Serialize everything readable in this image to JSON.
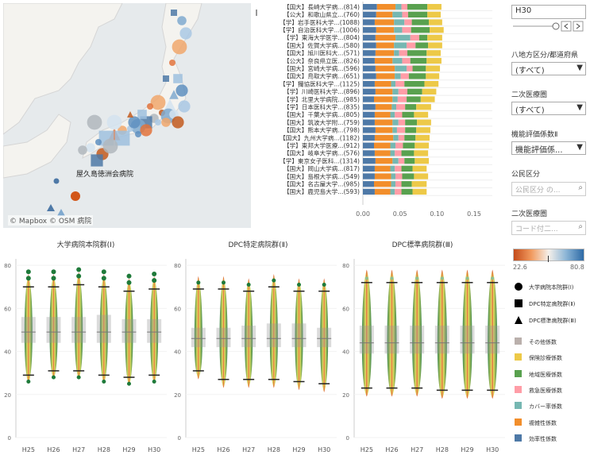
{
  "map": {
    "credit": "© Mapbox  © OSM",
    "hospital_label": "屋久島徳洲会病院",
    "partial_label": "病院"
  },
  "bars": {
    "labels": [
      "【国大】長崎大学病...(814)",
      "【公大】和歌山県立...(760)",
      "【学】岩手医科大学...(1088)",
      "【学】自治医科大学...(1006)",
      "【学】東海大学医学...(804)",
      "【国大】佐賀大学病...(580)",
      "【国大】旭川医科大...(571)",
      "【公大】奈良県立医...(826)",
      "【国大】宮崎大学病...(596)",
      "【国大】鳥取大学病...(651)",
      "【学】獨協医科大学...(1125)",
      "【学】川崎医科大学...(896)",
      "【学】北里大学病院...(985)",
      "【学】日本医科大学...(835)",
      "【国大】千葉大学病...(805)",
      "【国大】筑波大学附...(759)",
      "【国大】熊本大学病...(798)",
      "【国大】九州大学病...(1182)",
      "【学】東邦大学医療...(912)",
      "【国大】岐阜大学病...(576)",
      "【学】東京女子医科...(1314)",
      "【国大】岡山大学病...(817)",
      "【国大】島根大学病...(549)",
      "【国大】名古屋大学...(985)",
      "【国大】鹿児島大学...(593)"
    ],
    "axis_ticks": [
      "0.00",
      "0.05",
      "0.10",
      "0.15"
    ]
  },
  "filters": {
    "year": "H30",
    "region_label": "八地方区分/都道府県",
    "region_value": "(すべて)",
    "medical_area_label": "二次医療圏",
    "medical_area_value": "(すべて)",
    "coef_label": "機能評価係数Ⅱ",
    "coef_value": "機能評価係...",
    "public_label": "公民区分",
    "public_placeholder": "公民区分 の...",
    "area2_label": "二次医療圏",
    "area2_placeholder": "コード付二..."
  },
  "color_scale": {
    "min": "22.6",
    "max": "80.8"
  },
  "shape_legend": [
    {
      "shape": "circle",
      "label": "大学病院本院群(Ⅰ)"
    },
    {
      "shape": "square",
      "label": "DPC特定病院群(Ⅱ)"
    },
    {
      "shape": "triangle",
      "label": "DPC標準病院群(Ⅲ)"
    }
  ],
  "color_legend": [
    {
      "label": "その他係数",
      "color": "#bab0ac"
    },
    {
      "label": "保険診療係数",
      "color": "#edc948"
    },
    {
      "label": "地域医療係数",
      "color": "#59a14f"
    },
    {
      "label": "救急医療係数",
      "color": "#ff9da7"
    },
    {
      "label": "カバー率係数",
      "color": "#76b7b2"
    },
    {
      "label": "複雑性係数",
      "color": "#f28e2b"
    },
    {
      "label": "効率性係数",
      "color": "#4e79a7"
    }
  ],
  "violin": {
    "titles": [
      "大学病院本院群(Ⅰ)",
      "DPC特定病院群(Ⅱ)",
      "DPC標準病院群(Ⅲ)"
    ],
    "years": [
      "H25",
      "H26",
      "H27",
      "H28",
      "H29",
      "H30"
    ],
    "y_ticks": [
      "0",
      "20",
      "40",
      "60",
      "80"
    ]
  },
  "chart_data": [
    {
      "type": "bar",
      "title": "",
      "stacked": true,
      "orientation": "horizontal",
      "categories": [
        "【国大】長崎大学病...(814)",
        "【公大】和歌山県立...(760)",
        "【学】岩手医科大学...(1088)",
        "【学】自治医科大学...(1006)",
        "【学】東海大学医学...(804)",
        "【国大】佐賀大学病...(580)",
        "【国大】旭川医科大...(571)",
        "【公大】奈良県立医...(826)",
        "【国大】宮崎大学病...(596)",
        "【国大】鳥取大学病...(651)",
        "【学】獨協医科大学...(1125)",
        "【学】川崎医科大学...(896)",
        "【学】北里大学病院...(985)",
        "【学】日本医科大学...(835)",
        "【国大】千葉大学病...(805)",
        "【国大】筑波大学附...(759)",
        "【国大】熊本大学病...(798)",
        "【国大】九州大学病...(1182)",
        "【学】東邦大学医療...(912)",
        "【国大】岐阜大学病...(576)",
        "【学】東京女子医科...(1314)",
        "【国大】岡山大学病...(817)",
        "【国大】島根大学病...(549)",
        "【国大】名古屋大学...(985)",
        "【国大】鹿児島大学...(593)"
      ],
      "series": [
        {
          "name": "効率性係数",
          "values": [
            0.019,
            0.018,
            0.016,
            0.018,
            0.017,
            0.018,
            0.017,
            0.016,
            0.017,
            0.018,
            0.016,
            0.017,
            0.015,
            0.017,
            0.016,
            0.016,
            0.017,
            0.016,
            0.015,
            0.016,
            0.017,
            0.016,
            0.016,
            0.015,
            0.016
          ]
        },
        {
          "name": "複雑性係数",
          "values": [
            0.025,
            0.022,
            0.026,
            0.024,
            0.027,
            0.024,
            0.025,
            0.024,
            0.026,
            0.025,
            0.022,
            0.023,
            0.025,
            0.022,
            0.021,
            0.024,
            0.023,
            0.025,
            0.022,
            0.021,
            0.023,
            0.021,
            0.022,
            0.023,
            0.021
          ]
        },
        {
          "name": "カバー率係数",
          "values": [
            0.008,
            0.013,
            0.014,
            0.011,
            0.02,
            0.017,
            0.007,
            0.013,
            0.016,
            0.008,
            0.006,
            0.008,
            0.007,
            0.006,
            0.006,
            0.008,
            0.006,
            0.007,
            0.007,
            0.006,
            0.008,
            0.006,
            0.006,
            0.006,
            0.006
          ]
        },
        {
          "name": "救急医療係数",
          "values": [
            0.008,
            0.008,
            0.01,
            0.012,
            0.012,
            0.012,
            0.011,
            0.011,
            0.008,
            0.011,
            0.012,
            0.012,
            0.012,
            0.012,
            0.01,
            0.009,
            0.011,
            0.008,
            0.01,
            0.009,
            0.008,
            0.009,
            0.009,
            0.008,
            0.009
          ]
        },
        {
          "name": "地域医療係数",
          "values": [
            0.027,
            0.026,
            0.023,
            0.025,
            0.011,
            0.017,
            0.026,
            0.022,
            0.018,
            0.023,
            0.027,
            0.02,
            0.019,
            0.015,
            0.016,
            0.016,
            0.015,
            0.015,
            0.016,
            0.017,
            0.014,
            0.015,
            0.016,
            0.014,
            0.015
          ]
        },
        {
          "name": "保険診療係数",
          "values": [
            0.019,
            0.018,
            0.018,
            0.019,
            0.02,
            0.019,
            0.019,
            0.02,
            0.019,
            0.018,
            0.019,
            0.019,
            0.019,
            0.02,
            0.019,
            0.019,
            0.019,
            0.019,
            0.019,
            0.019,
            0.019,
            0.019,
            0.019,
            0.02,
            0.019
          ]
        }
      ],
      "xlim": [
        0,
        0.16
      ]
    },
    {
      "type": "scatter",
      "title": "大学病院本院群(Ⅰ)",
      "x": [
        "H25",
        "H26",
        "H27",
        "H28",
        "H29",
        "H30"
      ],
      "median": [
        49,
        49,
        49,
        49,
        49,
        49
      ],
      "q1": [
        44,
        44,
        44,
        44,
        44,
        44
      ],
      "q3": [
        56,
        56,
        56,
        57,
        55,
        55
      ],
      "whisker_low": [
        29,
        31,
        31,
        29,
        28,
        29
      ],
      "whisker_high": [
        70,
        70,
        71,
        70,
        68,
        69
      ],
      "ylim": [
        0,
        80
      ]
    },
    {
      "type": "scatter",
      "title": "DPC特定病院群(Ⅱ)",
      "x": [
        "H25",
        "H26",
        "H27",
        "H28",
        "H29",
        "H30"
      ],
      "median": [
        46,
        46,
        46,
        46,
        46,
        46
      ],
      "q1": [
        42,
        42,
        42,
        42,
        42,
        42
      ],
      "q3": [
        51,
        51,
        52,
        53,
        53,
        51
      ],
      "whisker_low": [
        31,
        27,
        27,
        27,
        26,
        25
      ],
      "whisker_high": [
        69,
        69,
        68,
        70,
        68,
        68
      ],
      "ylim": [
        0,
        80
      ]
    },
    {
      "type": "scatter",
      "title": "DPC標準病院群(Ⅲ)",
      "x": [
        "H25",
        "H26",
        "H27",
        "H28",
        "H29",
        "H30"
      ],
      "median": [
        44,
        44,
        44,
        44,
        44,
        44
      ],
      "q1": [
        39,
        39,
        39,
        39,
        39,
        39
      ],
      "q3": [
        52,
        52,
        52,
        52,
        52,
        52
      ],
      "whisker_low": [
        23,
        23,
        23,
        22,
        22,
        22
      ],
      "whisker_high": [
        72,
        72,
        72,
        72,
        72,
        72
      ],
      "ylim": [
        0,
        80
      ]
    }
  ]
}
